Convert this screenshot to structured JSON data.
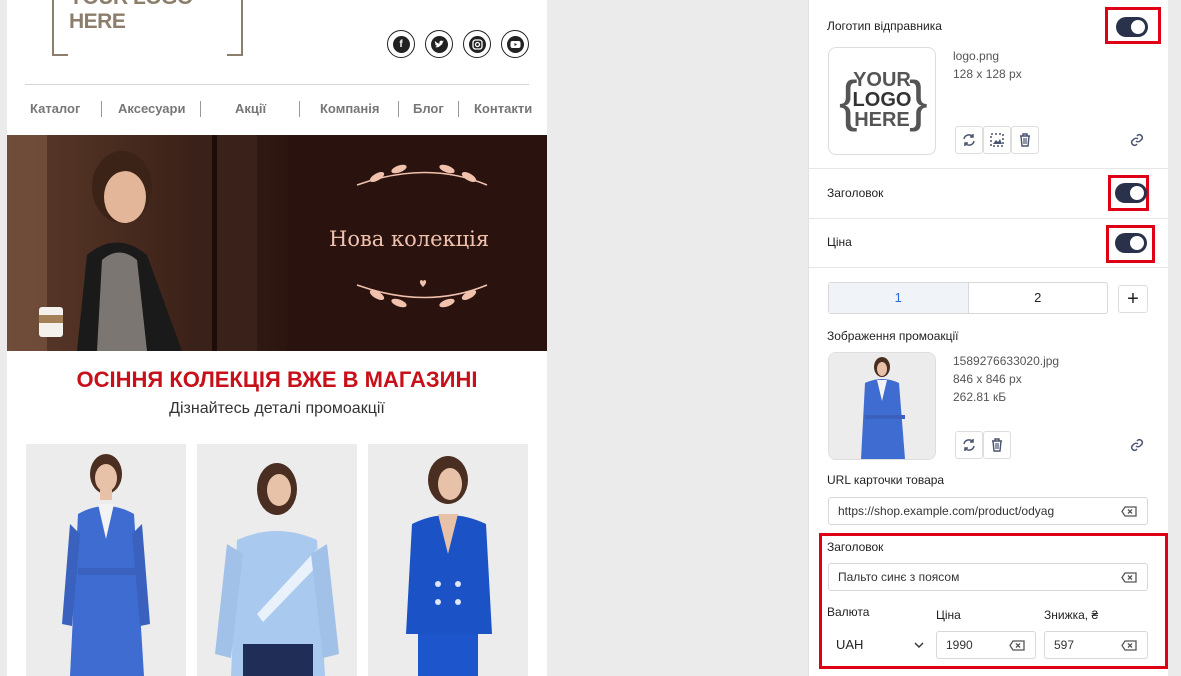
{
  "preview": {
    "logo_text": "YOUR LOGO HERE",
    "social_icons": [
      "facebook-icon",
      "twitter-icon",
      "instagram-icon",
      "youtube-icon"
    ],
    "nav": [
      "Каталог",
      "Аксесуари",
      "Акції",
      "Компанія",
      "Блог",
      "Контакти"
    ],
    "banner_text": "Нова колекція",
    "promo_title": "ОСІННЯ КОЛЕКЦІЯ ВЖЕ В МАГАЗИНІ",
    "promo_subtitle": "Дізнайтесь деталі промоакції",
    "colors": {
      "title_red": "#c7101a",
      "banner_bg": "#2a130e",
      "coat_blue": "#3f6cd1"
    }
  },
  "panel": {
    "sender_logo": {
      "title": "Логотип відправника",
      "enabled": true,
      "file_name": "logo.png",
      "dimensions": "128 x 128 px",
      "thumb_text": [
        "YOUR",
        "LOGO",
        "HERE"
      ]
    },
    "heading_toggle": {
      "title": "Заголовок",
      "enabled": true
    },
    "price_toggle": {
      "title": "Ціна",
      "enabled": true
    },
    "tabs": [
      "1",
      "2"
    ],
    "add_label": "+",
    "promo_image": {
      "title": "Зображення промоакції",
      "file_name": "1589276633020.jpg",
      "dimensions": "846 x 846 px",
      "size": "262.81 кБ"
    },
    "url": {
      "label": "URL карточки товара",
      "value": "https://shop.example.com/product/odyag"
    },
    "title_field": {
      "label": "Заголовок",
      "value": "Пальто синє з поясом"
    },
    "currency": {
      "label": "Валюта",
      "value": "UAH"
    },
    "price": {
      "label": "Ціна",
      "value": "1990"
    },
    "discount": {
      "label": "Знижка, ₴",
      "value": "597"
    },
    "colors": {
      "toggle_on": "#29324a",
      "highlight": "#e00016",
      "tab_active_bg": "#f0f4f8",
      "tab_active_text": "#2a6ad8"
    }
  }
}
